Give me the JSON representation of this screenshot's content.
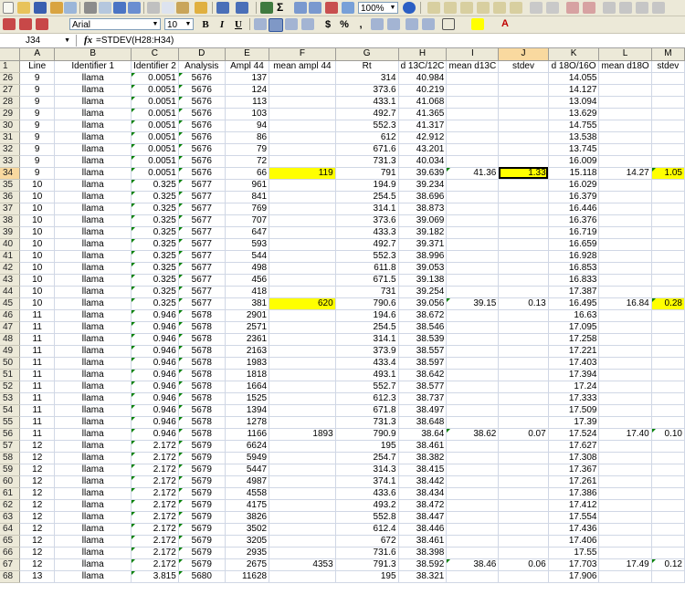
{
  "window": {
    "title": "Microsoft Excel"
  },
  "toolbar": {
    "zoom": "100%",
    "font_name": "Arial",
    "font_size": "10",
    "bold_label": "B",
    "italic_label": "I",
    "underline_label": "U",
    "currency_label": "$",
    "percent_label": "%",
    "comma_label": ",",
    "icons": [
      "new-icon",
      "open-icon",
      "save-icon",
      "permission-icon",
      "email-icon",
      "print-icon",
      "print-preview-icon",
      "spelling-icon",
      "research-icon",
      "cut-icon",
      "copy-icon",
      "paste-icon",
      "format-painter-icon",
      "undo-icon",
      "redo-icon",
      "hyperlink-icon",
      "autosum-icon",
      "sort-ascending-icon",
      "sort-descending-icon",
      "chart-wizard-icon",
      "drawing-icon",
      "zoom-icon",
      "help-icon"
    ]
  },
  "formula_bar": {
    "cell_ref": "J34",
    "fx": "fx",
    "formula": "=STDEV(H28:H34)"
  },
  "columns": [
    "A",
    "B",
    "C",
    "D",
    "E",
    "F",
    "G",
    "H",
    "I",
    "J",
    "K",
    "L",
    "M"
  ],
  "selected_column": "J",
  "header_row": {
    "num": "1",
    "cells": [
      "Line",
      "Identifier 1",
      "Identifier 2",
      "Analysis",
      "Ampl  44",
      "mean ampl 44",
      "Rt",
      "d 13C/12C",
      "mean d13C",
      "stdev",
      "d 18O/16O",
      "mean d18O",
      "stdev"
    ]
  },
  "rows": [
    {
      "num": "26",
      "c": [
        "9",
        "llama",
        "0.0051",
        "5676",
        "137",
        "",
        "314",
        "40.984",
        "",
        "",
        "14.055",
        "",
        ""
      ]
    },
    {
      "num": "27",
      "c": [
        "9",
        "llama",
        "0.0051",
        "5676",
        "124",
        "",
        "373.6",
        "40.219",
        "",
        "",
        "14.127",
        "",
        ""
      ]
    },
    {
      "num": "28",
      "c": [
        "9",
        "llama",
        "0.0051",
        "5676",
        "113",
        "",
        "433.1",
        "41.068",
        "",
        "",
        "13.094",
        "",
        ""
      ]
    },
    {
      "num": "29",
      "c": [
        "9",
        "llama",
        "0.0051",
        "5676",
        "103",
        "",
        "492.7",
        "41.365",
        "",
        "",
        "13.629",
        "",
        ""
      ]
    },
    {
      "num": "30",
      "c": [
        "9",
        "llama",
        "0.0051",
        "5676",
        "94",
        "",
        "552.3",
        "41.317",
        "",
        "",
        "14.755",
        "",
        ""
      ]
    },
    {
      "num": "31",
      "c": [
        "9",
        "llama",
        "0.0051",
        "5676",
        "86",
        "",
        "612",
        "42.912",
        "",
        "",
        "13.538",
        "",
        ""
      ]
    },
    {
      "num": "32",
      "c": [
        "9",
        "llama",
        "0.0051",
        "5676",
        "79",
        "",
        "671.6",
        "43.201",
        "",
        "",
        "13.745",
        "",
        ""
      ]
    },
    {
      "num": "33",
      "c": [
        "9",
        "llama",
        "0.0051",
        "5676",
        "72",
        "",
        "731.3",
        "40.034",
        "",
        "",
        "16.009",
        "",
        ""
      ]
    },
    {
      "num": "34",
      "c": [
        "9",
        "llama",
        "0.0051",
        "5676",
        "66",
        "119",
        "791",
        "39.639",
        "41.36",
        "1.33",
        "15.118",
        "14.27",
        "1.05"
      ]
    },
    {
      "num": "35",
      "c": [
        "10",
        "llama",
        "0.325",
        "5677",
        "961",
        "",
        "194.9",
        "39.234",
        "",
        "",
        "16.029",
        "",
        ""
      ]
    },
    {
      "num": "36",
      "c": [
        "10",
        "llama",
        "0.325",
        "5677",
        "841",
        "",
        "254.5",
        "38.696",
        "",
        "",
        "16.379",
        "",
        ""
      ]
    },
    {
      "num": "37",
      "c": [
        "10",
        "llama",
        "0.325",
        "5677",
        "769",
        "",
        "314.1",
        "38.873",
        "",
        "",
        "16.446",
        "",
        ""
      ]
    },
    {
      "num": "38",
      "c": [
        "10",
        "llama",
        "0.325",
        "5677",
        "707",
        "",
        "373.6",
        "39.069",
        "",
        "",
        "16.376",
        "",
        ""
      ]
    },
    {
      "num": "39",
      "c": [
        "10",
        "llama",
        "0.325",
        "5677",
        "647",
        "",
        "433.3",
        "39.182",
        "",
        "",
        "16.719",
        "",
        ""
      ]
    },
    {
      "num": "40",
      "c": [
        "10",
        "llama",
        "0.325",
        "5677",
        "593",
        "",
        "492.7",
        "39.371",
        "",
        "",
        "16.659",
        "",
        ""
      ]
    },
    {
      "num": "41",
      "c": [
        "10",
        "llama",
        "0.325",
        "5677",
        "544",
        "",
        "552.3",
        "38.996",
        "",
        "",
        "16.928",
        "",
        ""
      ]
    },
    {
      "num": "42",
      "c": [
        "10",
        "llama",
        "0.325",
        "5677",
        "498",
        "",
        "611.8",
        "39.053",
        "",
        "",
        "16.853",
        "",
        ""
      ]
    },
    {
      "num": "43",
      "c": [
        "10",
        "llama",
        "0.325",
        "5677",
        "456",
        "",
        "671.5",
        "39.138",
        "",
        "",
        "16.833",
        "",
        ""
      ]
    },
    {
      "num": "44",
      "c": [
        "10",
        "llama",
        "0.325",
        "5677",
        "418",
        "",
        "731",
        "39.254",
        "",
        "",
        "17.387",
        "",
        ""
      ]
    },
    {
      "num": "45",
      "c": [
        "10",
        "llama",
        "0.325",
        "5677",
        "381",
        "620",
        "790.6",
        "39.056",
        "39.15",
        "0.13",
        "16.495",
        "16.84",
        "0.28"
      ]
    },
    {
      "num": "46",
      "c": [
        "11",
        "llama",
        "0.946",
        "5678",
        "2901",
        "",
        "194.6",
        "38.672",
        "",
        "",
        "16.63",
        "",
        ""
      ]
    },
    {
      "num": "47",
      "c": [
        "11",
        "llama",
        "0.946",
        "5678",
        "2571",
        "",
        "254.5",
        "38.546",
        "",
        "",
        "17.095",
        "",
        ""
      ]
    },
    {
      "num": "48",
      "c": [
        "11",
        "llama",
        "0.946",
        "5678",
        "2361",
        "",
        "314.1",
        "38.539",
        "",
        "",
        "17.258",
        "",
        ""
      ]
    },
    {
      "num": "49",
      "c": [
        "11",
        "llama",
        "0.946",
        "5678",
        "2163",
        "",
        "373.9",
        "38.557",
        "",
        "",
        "17.221",
        "",
        ""
      ]
    },
    {
      "num": "50",
      "c": [
        "11",
        "llama",
        "0.946",
        "5678",
        "1983",
        "",
        "433.4",
        "38.597",
        "",
        "",
        "17.403",
        "",
        ""
      ]
    },
    {
      "num": "51",
      "c": [
        "11",
        "llama",
        "0.946",
        "5678",
        "1818",
        "",
        "493.1",
        "38.642",
        "",
        "",
        "17.394",
        "",
        ""
      ]
    },
    {
      "num": "52",
      "c": [
        "11",
        "llama",
        "0.946",
        "5678",
        "1664",
        "",
        "552.7",
        "38.577",
        "",
        "",
        "17.24",
        "",
        ""
      ]
    },
    {
      "num": "53",
      "c": [
        "11",
        "llama",
        "0.946",
        "5678",
        "1525",
        "",
        "612.3",
        "38.737",
        "",
        "",
        "17.333",
        "",
        ""
      ]
    },
    {
      "num": "54",
      "c": [
        "11",
        "llama",
        "0.946",
        "5678",
        "1394",
        "",
        "671.8",
        "38.497",
        "",
        "",
        "17.509",
        "",
        ""
      ]
    },
    {
      "num": "55",
      "c": [
        "11",
        "llama",
        "0.946",
        "5678",
        "1278",
        "",
        "731.3",
        "38.648",
        "",
        "",
        "17.39",
        "",
        ""
      ]
    },
    {
      "num": "56",
      "c": [
        "11",
        "llama",
        "0.946",
        "5678",
        "1166",
        "1893",
        "790.9",
        "38.64",
        "38.62",
        "0.07",
        "17.524",
        "17.40",
        "0.10"
      ]
    },
    {
      "num": "57",
      "c": [
        "12",
        "llama",
        "2.172",
        "5679",
        "6624",
        "",
        "195",
        "38.461",
        "",
        "",
        "17.627",
        "",
        ""
      ]
    },
    {
      "num": "58",
      "c": [
        "12",
        "llama",
        "2.172",
        "5679",
        "5949",
        "",
        "254.7",
        "38.382",
        "",
        "",
        "17.308",
        "",
        ""
      ]
    },
    {
      "num": "59",
      "c": [
        "12",
        "llama",
        "2.172",
        "5679",
        "5447",
        "",
        "314.3",
        "38.415",
        "",
        "",
        "17.367",
        "",
        ""
      ]
    },
    {
      "num": "60",
      "c": [
        "12",
        "llama",
        "2.172",
        "5679",
        "4987",
        "",
        "374.1",
        "38.442",
        "",
        "",
        "17.261",
        "",
        ""
      ]
    },
    {
      "num": "61",
      "c": [
        "12",
        "llama",
        "2.172",
        "5679",
        "4558",
        "",
        "433.6",
        "38.434",
        "",
        "",
        "17.386",
        "",
        ""
      ]
    },
    {
      "num": "62",
      "c": [
        "12",
        "llama",
        "2.172",
        "5679",
        "4175",
        "",
        "493.2",
        "38.472",
        "",
        "",
        "17.412",
        "",
        ""
      ]
    },
    {
      "num": "63",
      "c": [
        "12",
        "llama",
        "2.172",
        "5679",
        "3826",
        "",
        "552.8",
        "38.447",
        "",
        "",
        "17.554",
        "",
        ""
      ]
    },
    {
      "num": "64",
      "c": [
        "12",
        "llama",
        "2.172",
        "5679",
        "3502",
        "",
        "612.4",
        "38.446",
        "",
        "",
        "17.436",
        "",
        ""
      ]
    },
    {
      "num": "65",
      "c": [
        "12",
        "llama",
        "2.172",
        "5679",
        "3205",
        "",
        "672",
        "38.461",
        "",
        "",
        "17.406",
        "",
        ""
      ]
    },
    {
      "num": "66",
      "c": [
        "12",
        "llama",
        "2.172",
        "5679",
        "2935",
        "",
        "731.6",
        "38.398",
        "",
        "",
        "17.55",
        "",
        ""
      ]
    },
    {
      "num": "67",
      "c": [
        "12",
        "llama",
        "2.172",
        "5679",
        "2675",
        "4353",
        "791.3",
        "38.592",
        "38.46",
        "0.06",
        "17.703",
        "17.49",
        "0.12"
      ]
    },
    {
      "num": "68",
      "c": [
        "13",
        "llama",
        "3.815",
        "5680",
        "11628",
        "",
        "195",
        "38.321",
        "",
        "",
        "17.906",
        "",
        ""
      ]
    }
  ],
  "colors": {
    "highlight": "#ffff00",
    "header_bg": "#ece9d8",
    "selected_header": "#f9d99f",
    "gridline": "#d0d7e5"
  }
}
